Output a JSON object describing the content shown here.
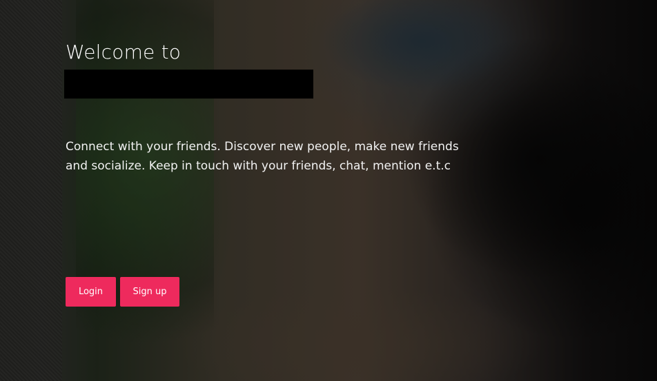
{
  "hero": {
    "welcome_text": "Welcome to",
    "description": "Connect with your friends. Discover new people, make new friends and socialize. Keep in touch with your friends, chat, mention e.t.c",
    "background_image": "parkour-person-flipping-in-street"
  },
  "actions": {
    "login_label": "Login",
    "signup_label": "Sign up"
  },
  "colors": {
    "accent": "#ee2a5d",
    "text": "#ffffff",
    "redaction": "#000000"
  }
}
